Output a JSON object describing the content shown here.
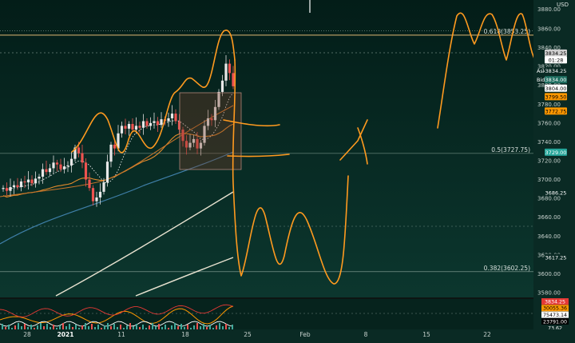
{
  "chart_data": {
    "type": "candlestick",
    "currency_label": "USD",
    "y_ticks": [
      3860.0,
      3840.0,
      3820.0,
      3800.0,
      3780.0,
      3760.0,
      3740.0,
      3720.0,
      3700.0,
      3680.0,
      3660.0,
      3640.0,
      3620.0,
      3600.0,
      3580.0
    ],
    "top_cut_tick": "3880.00",
    "x_ticks": [
      "28",
      "2021",
      "11",
      "18",
      "25",
      "Feb",
      "8",
      "15",
      "22"
    ],
    "fib_levels": [
      {
        "label": "0.618(3853.25)",
        "value": 3853.25
      },
      {
        "label": "0.5(3727.75)",
        "value": 3727.75
      },
      {
        "label": "0.382(3602.25)",
        "value": 3602.25
      }
    ],
    "price_tags": [
      {
        "text": "3834.25",
        "value": 3834.25,
        "color": "#d0d0d0",
        "text_color": "#000000"
      },
      {
        "text": "01:28",
        "value": 3827.0,
        "color": "#ffffff",
        "text_color": "#000000"
      },
      {
        "text": "Ask",
        "value": 3815.5,
        "color": "#0a2a24",
        "text_color": "#ffffff",
        "prefix_only": true
      },
      {
        "text": "3834.25",
        "value": 3815.5,
        "color": "#0a2a24",
        "text_color": "#ffffff"
      },
      {
        "text": "Bid",
        "value": 3806.0,
        "color": "#1e6e60",
        "text_color": "#ffffff",
        "prefix_only": true
      },
      {
        "text": "3834.00",
        "value": 3806.0,
        "color": "#1e6e60",
        "text_color": "#ffffff"
      },
      {
        "text": "3804.00",
        "value": 3797.0,
        "color": "#ffffff",
        "text_color": "#000000"
      },
      {
        "text": "3799.50",
        "value": 3788.0,
        "color": "#ff9800",
        "text_color": "#000000"
      },
      {
        "text": "3772.75",
        "value": 3772.75,
        "color": "#ff9800",
        "text_color": "#000000"
      },
      {
        "text": "3729.00",
        "value": 3729.0,
        "color": "#26a69a",
        "text_color": "#ffffff"
      },
      {
        "text": "3686.25",
        "value": 3686.25,
        "color": "#0a2a24",
        "text_color": "#ffffff"
      },
      {
        "text": "3617.25",
        "value": 3617.25,
        "color": "#0a2a24",
        "text_color": "#ffffff"
      }
    ],
    "indicator_tags": [
      {
        "text": "3834.25",
        "color": "#e53935",
        "text_color": "#ffffff"
      },
      {
        "text": "30055.36",
        "color": "#ff9800",
        "text_color": "#000000"
      },
      {
        "text": "75473.14",
        "color": "#ffffff",
        "text_color": "#000000"
      },
      {
        "text": "23791.00",
        "color": "#000000",
        "text_color": "#ffffff"
      },
      {
        "text": "73.62",
        "color": "#0a2a24",
        "text_color": "#ffffff"
      }
    ],
    "ohlc_start": 3690,
    "ohlc_steps": [
      1,
      -3,
      4,
      2,
      -2,
      6,
      -1,
      3,
      -4,
      5,
      2,
      8,
      -3,
      4,
      6,
      -2,
      -5,
      3,
      1,
      7,
      12,
      -6,
      -10,
      -18,
      -9,
      -14,
      4,
      6,
      10,
      22,
      18,
      -4,
      16,
      8,
      -3,
      5,
      -6,
      4,
      -2,
      7,
      -5,
      3,
      2,
      -4,
      6,
      -2,
      3,
      5,
      -8,
      -9,
      -12,
      -7,
      5,
      4,
      -10,
      6,
      18,
      8,
      -2,
      14,
      16,
      12,
      18,
      -10,
      -14
    ],
    "ohlc_unit_values": true
  }
}
